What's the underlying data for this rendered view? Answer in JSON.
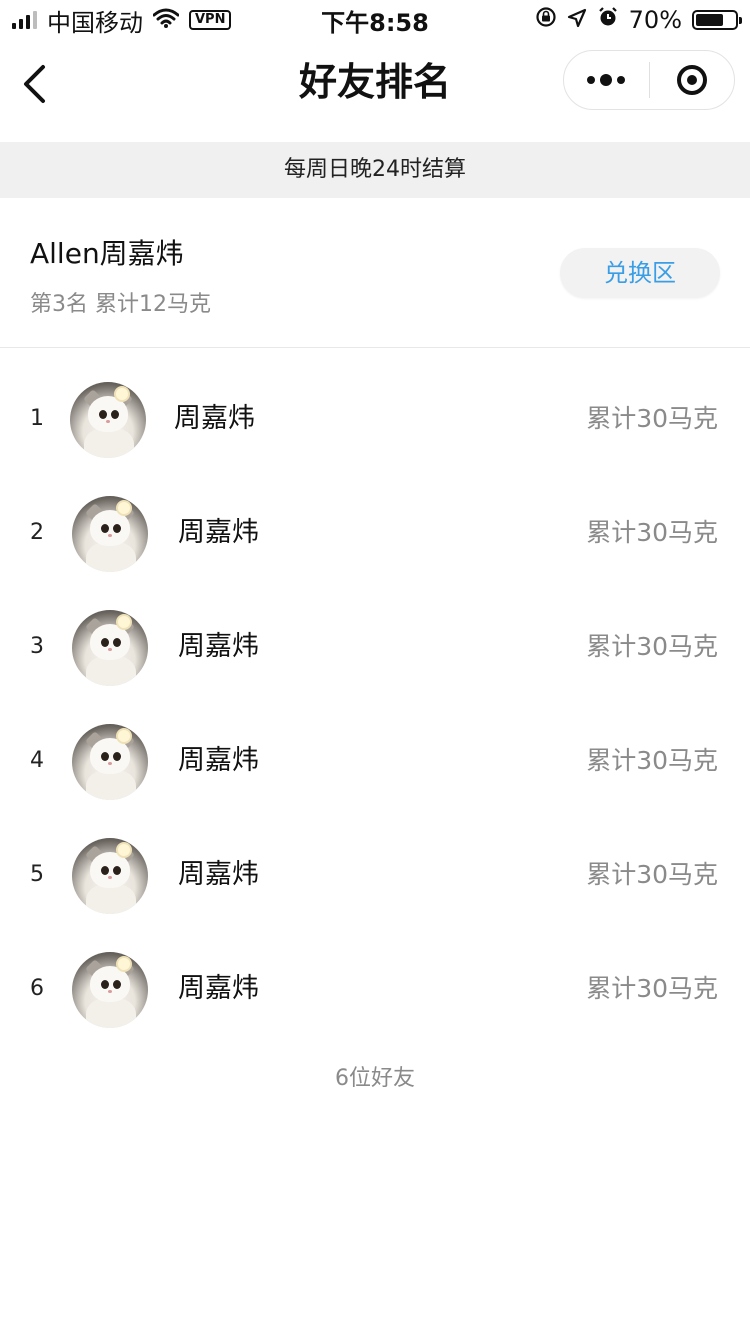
{
  "status_bar": {
    "carrier": "中国移动",
    "vpn": "VPN",
    "time": "下午8:58",
    "battery": "70%",
    "battery_level": 0.7,
    "icons": [
      "signal-icon",
      "wifi-icon",
      "rotation-lock-icon",
      "location-icon",
      "alarm-icon",
      "battery-icon"
    ]
  },
  "nav": {
    "title": "好友排名",
    "icons": [
      "back-icon",
      "more-icon",
      "target-icon"
    ]
  },
  "notice": "每周日晚24时结算",
  "me": {
    "name": "Allen周嘉炜",
    "stats": "第3名 累计12马克",
    "redeem_label": "兑换区"
  },
  "ranking": [
    {
      "rank": "1",
      "name": "周嘉炜",
      "score": "累计30马克"
    },
    {
      "rank": "2",
      "name": "周嘉炜",
      "score": "累计30马克"
    },
    {
      "rank": "3",
      "name": "周嘉炜",
      "score": "累计30马克"
    },
    {
      "rank": "4",
      "name": "周嘉炜",
      "score": "累计30马克"
    },
    {
      "rank": "5",
      "name": "周嘉炜",
      "score": "累计30马克"
    },
    {
      "rank": "6",
      "name": "周嘉炜",
      "score": "累计30马克"
    }
  ],
  "footer": "6位好友",
  "colors": {
    "accent": "#3a9ee6",
    "muted_text": "#8a8a8a",
    "notice_bg": "#f0f0f0"
  }
}
